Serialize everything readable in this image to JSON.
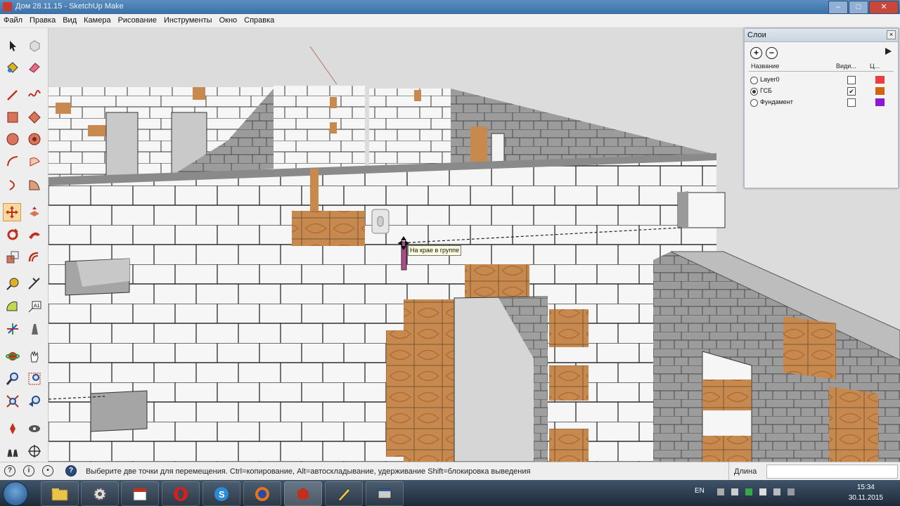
{
  "window": {
    "title": "Дом 28.11.15 - SketchUp Make",
    "controls": [
      "–",
      "□",
      "✕"
    ]
  },
  "menu": [
    "Файл",
    "Правка",
    "Вид",
    "Камера",
    "Рисование",
    "Инструменты",
    "Окно",
    "Справка"
  ],
  "tools": [
    "select-icon",
    "eraser-icon",
    "paint-bucket-icon",
    "eraser-pink-icon",
    "line-icon",
    "freehand-icon",
    "rectangle-icon",
    "rotated-rectangle-icon",
    "circle-icon",
    "polygon-icon",
    "arc-icon",
    "pie-icon",
    "two-point-arc-icon",
    "three-point-arc-icon",
    "move-icon",
    "push-pull-icon",
    "rotate-icon",
    "follow-me-icon",
    "scale-icon",
    "offset-icon",
    "tape-measure-icon",
    "dimension-icon",
    "protractor-icon",
    "text-icon",
    "axes-icon",
    "3d-text-icon",
    "orbit-icon",
    "pan-icon",
    "zoom-icon",
    "zoom-window-icon",
    "zoom-extents-icon",
    "previous-view-icon",
    "position-camera-icon",
    "walk-icon",
    "look-around-icon",
    "section-plane-icon"
  ],
  "layers_panel": {
    "title": "Слои",
    "columns": {
      "name": "Название",
      "visible": "Види...",
      "color": "Ц..."
    },
    "rows": [
      {
        "name": "Layer0",
        "visible": false,
        "active": false,
        "color": "#e8403c"
      },
      {
        "name": "ГСБ",
        "visible": true,
        "active": true,
        "color": "#d4620e"
      },
      {
        "name": "Фундамент",
        "visible": false,
        "active": false,
        "color": "#8a1bd4"
      }
    ]
  },
  "tooltip": "На крае в группе",
  "status": {
    "message": "Выберите две точки для перемещения. Ctrl=копирование, Alt=автоскладывание, удерживание Shift=блокировка выведения",
    "length_label": "Длина",
    "length_value": ""
  },
  "taskbar": {
    "apps": [
      "file-explorer-icon",
      "settings-icon",
      "calendar-icon",
      "opera-icon",
      "skype-icon",
      "firefox-icon",
      "sketchup-icon",
      "pencil-app-icon",
      "window-app-icon"
    ],
    "language": "EN",
    "time": "15:34",
    "date": "30.11.2015"
  },
  "colors": {
    "brick": "#c8894f",
    "block": "#f4f4f4",
    "grey_block": "#9a9a9a",
    "sky": "#dcdcdc"
  }
}
